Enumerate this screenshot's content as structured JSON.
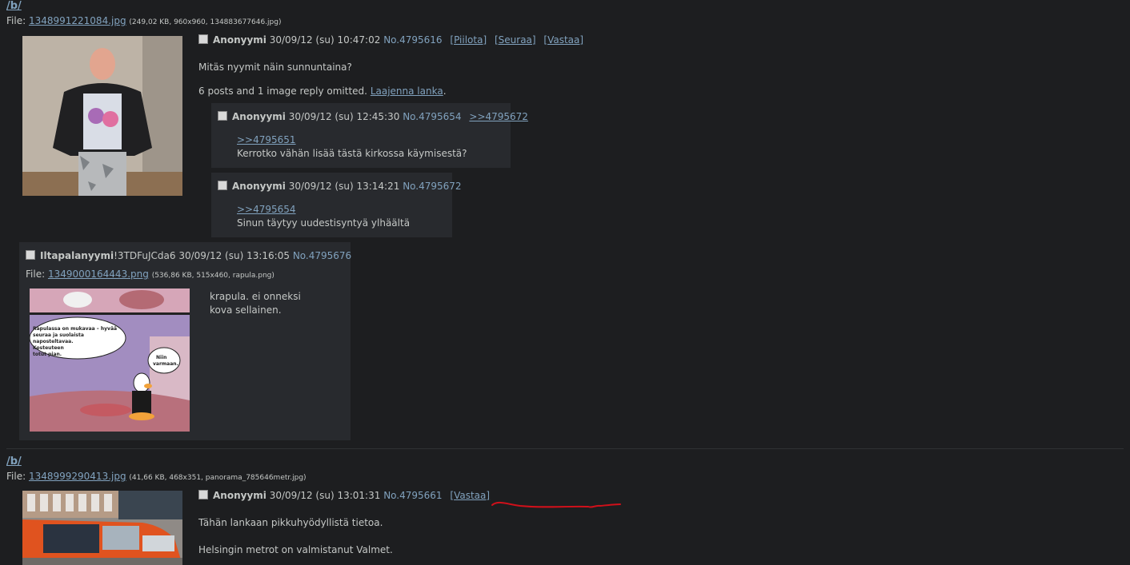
{
  "threads": [
    {
      "board_label": "/b/",
      "file_label": "File:",
      "file_name": "1348991221084.jpg",
      "file_meta": "(249,02 KB, 960x960, 134883677646.jpg)",
      "op": {
        "name": "Anonyymi",
        "date": "30/09/12 (su) 10:47:02",
        "post_no": "No.4795616",
        "actions": [
          "[Piilota]",
          "[Seuraa]",
          "[Vastaa]"
        ],
        "comment": "Mitäs nyymit näin sunnuntaina?",
        "omitted": "6 posts and 1 image reply omitted.",
        "expand": "Laajenna lanka",
        "period": "."
      },
      "replies": [
        {
          "name": "Anonyymi",
          "date": "30/09/12 (su) 12:45:30",
          "post_no": "No.4795654",
          "backlink": ">>4795672",
          "quote": ">>4795651",
          "text": "Kerrotko vähän lisää tästä kirkossa käymisestä?"
        },
        {
          "name": "Anonyymi",
          "date": "30/09/12 (su) 13:14:21",
          "post_no": "No.4795672",
          "quote": ">>4795654",
          "text": "Sinun täytyy uudestisyntyä ylhäältä"
        },
        {
          "name": "Iltapalanyymi",
          "tripcode": "!3TDFuJCda6",
          "date": "30/09/12 (su) 13:16:05",
          "post_no": "No.4795676",
          "file_label": "File:",
          "file_name": "1349000164443.png",
          "file_meta": "(536,86 KB, 515x460, rapula.png)",
          "text_lines": [
            "krapula. ei onneksi",
            "kova sellainen."
          ],
          "image_text": {
            "bubble": [
              "Rapulassa on mukavaa – hyvää",
              "seuraa ja suolaista",
              "naposteltavaa.",
              "Kosteuteen",
              "totut pian."
            ],
            "reply_bubble": [
              "Niin",
              "varmaan."
            ]
          }
        }
      ]
    },
    {
      "board_label": "/b/",
      "file_label": "File:",
      "file_name": "1348999290413.jpg",
      "file_meta": "(41,66 KB, 468x351, panorama_785646metr.jpg)",
      "op": {
        "name": "Anonyymi",
        "date": "30/09/12 (su) 13:01:31",
        "post_no": "No.4795661",
        "actions": [
          "[Vastaa]"
        ],
        "comment_lines": [
          "Tähän lankaan pikkuhyödyllistä tietoa.",
          "Helsingin metrot on valmistanut Valmet."
        ]
      }
    }
  ],
  "colors": {
    "background": "#1d1e20",
    "reply_bg": "#282a2e",
    "text": "#c5c8c6",
    "link": "#81a2be",
    "annotation": "#d0101a"
  }
}
